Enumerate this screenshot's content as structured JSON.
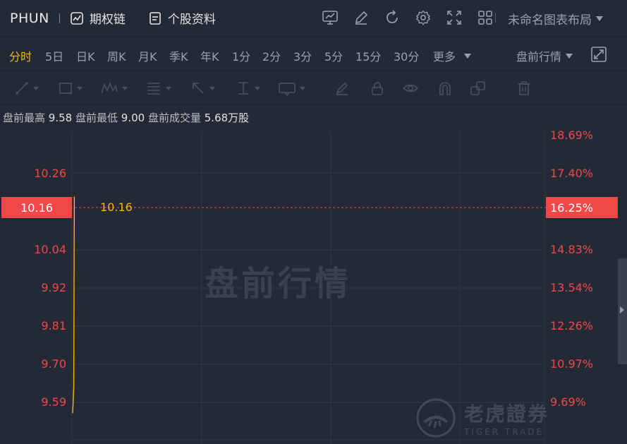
{
  "header": {
    "ticker": "PHUN",
    "options_link": "期权链",
    "profile_link": "个股资料",
    "layout_name": "未命名图表布局",
    "icons": [
      "chart-monitor-icon",
      "edit-pen-icon",
      "refresh-icon",
      "settings-gear-icon",
      "fullscreen-icon",
      "grid-layout-icon"
    ]
  },
  "periods": {
    "items": [
      "分时",
      "5日",
      "日K",
      "周K",
      "月K",
      "季K",
      "年K",
      "1分",
      "2分",
      "3分",
      "5分",
      "15分",
      "30分",
      "更多"
    ],
    "active": "分时",
    "session": "盘前行情"
  },
  "info": {
    "high_label": "盘前最高",
    "high_value": "9.58",
    "low_label": "盘前最低",
    "low_value": "9.00",
    "volume_label": "盘前成交量",
    "volume_value": "5.68万股"
  },
  "chart": {
    "watermark": "盘前行情",
    "current_price": "10.16",
    "current_pct": "16.25%",
    "line_price_label": "10.16",
    "left_axis": [
      "10.26",
      "10.04",
      "9.92",
      "9.81",
      "9.70",
      "9.59"
    ],
    "right_axis": [
      "18.69%",
      "17.40%",
      "14.83%",
      "13.54%",
      "12.26%",
      "10.97%",
      "9.69%"
    ],
    "colors": {
      "up": "#f04848",
      "price_line": "#f5b800",
      "grid": "#303743"
    }
  },
  "chart_data": {
    "type": "line",
    "title": "",
    "xlabel": "",
    "ylabel": "",
    "ylim": [
      9.52,
      10.33
    ],
    "series": [
      {
        "x": [
          0,
          1,
          2,
          3
        ],
        "y": [
          9.59,
          9.62,
          9.66,
          10.16
        ]
      }
    ]
  },
  "branding": {
    "logo_cn": "老虎證券",
    "logo_en": "TIGER TRADE"
  }
}
